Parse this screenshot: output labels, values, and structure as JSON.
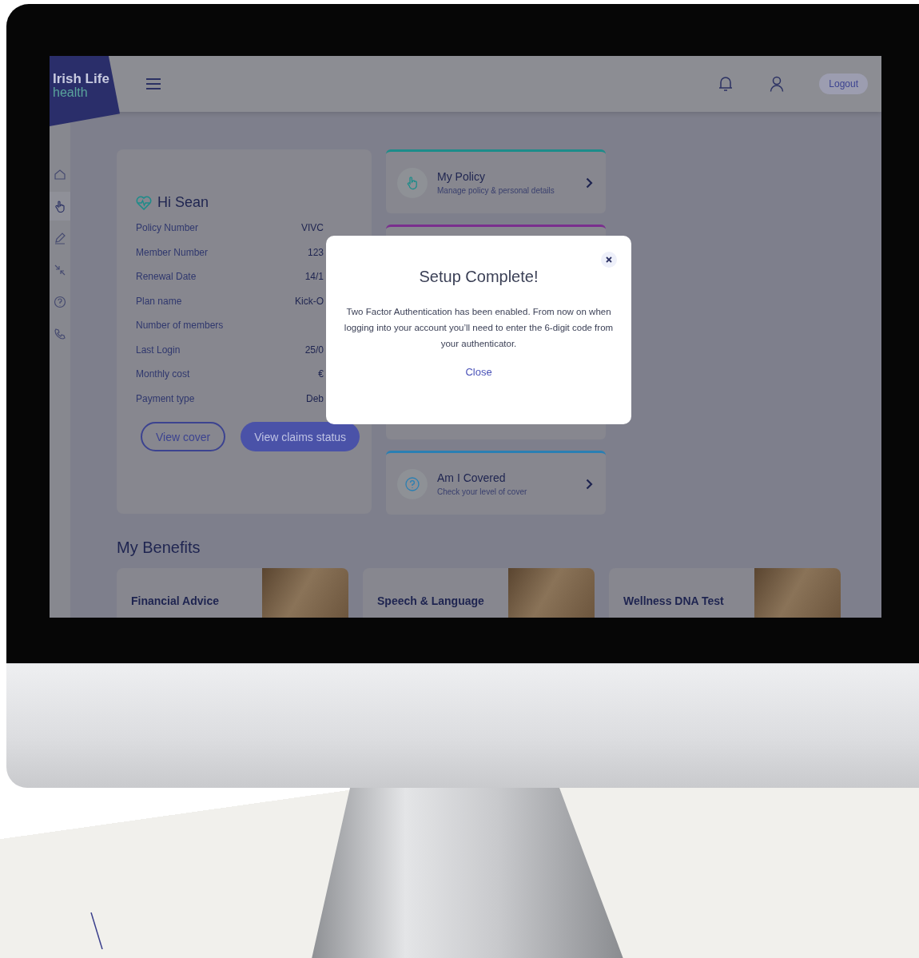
{
  "header": {
    "logo": {
      "line_1": "Irish Life",
      "line_2": "health"
    },
    "logout_button": "Logout"
  },
  "sidebar": {
    "items": [
      {
        "selected": false
      },
      {
        "selected": true
      },
      {
        "selected": false
      },
      {
        "selected": false
      },
      {
        "selected": false
      },
      {
        "selected": false
      }
    ]
  },
  "greeting_card": {
    "greeting": "Hi Sean",
    "fields": [
      {
        "label": "Policy Number",
        "value": "VIVC"
      },
      {
        "label": "Member Number",
        "value": "123"
      },
      {
        "label": "Renewal Date",
        "value": "14/1"
      },
      {
        "label": "Plan name",
        "value": "Kick-O"
      },
      {
        "label": "Number of members"
      },
      {
        "label": "Last Login",
        "value": "25/0"
      },
      {
        "label": "Monthly cost",
        "value": "€"
      },
      {
        "label": "Payment type",
        "value": "Deb"
      }
    ],
    "buttons": [
      {
        "label": "View cover",
        "kind": "outline"
      },
      {
        "label": "View claims status",
        "kind": "filled"
      }
    ]
  },
  "quick_links": [
    {
      "title": "My Policy",
      "subtitle": "Manage policy & personal details",
      "color": "#1d8c8a",
      "kind": "policy"
    },
    {
      "color": "#7a2f8e"
    },
    {
      "title": "Am I Covered",
      "subtitle": "Check your level of cover",
      "color": "#2a7fb3",
      "kind": "question"
    }
  ],
  "benefits": {
    "title": "My Benefits",
    "cards": [
      {
        "title": "Financial Advice"
      },
      {
        "title": "Speech & Language"
      },
      {
        "title": "Wellness DNA Test"
      }
    ]
  },
  "modal": {
    "title": "Setup Complete!",
    "message": "Two Factor Authentication has been enabled. From now on when logging into your account you’ll need to enter the 6-digit code from your authenticator.",
    "close_link": "Close"
  }
}
